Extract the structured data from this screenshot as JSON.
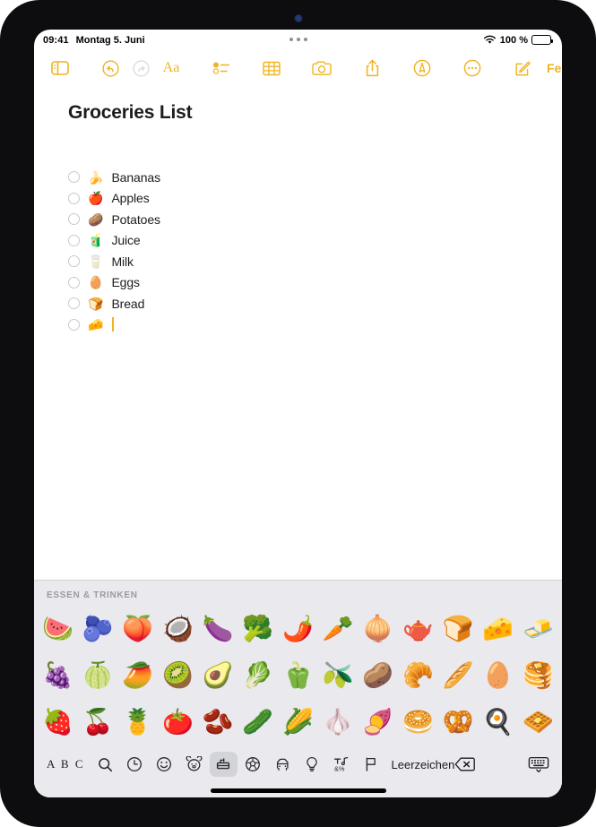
{
  "status_bar": {
    "time": "09:41",
    "date": "Montag 5. Juni",
    "wifi_icon": "wifi-icon",
    "battery_percent": "100 %",
    "battery_level": 100,
    "multitasking_icon": "multitasking-dots-icon"
  },
  "toolbar": {
    "sidebar_label": "sidebar-toggle",
    "undo_label": "undo",
    "redo_label": "redo",
    "format_label": "Aa",
    "checklist_label": "checklist",
    "table_label": "table",
    "camera_label": "camera",
    "share_label": "share",
    "markup_label": "markup",
    "more_label": "more",
    "compose_label": "compose",
    "done_label": "Fertig",
    "accent_color": "#EFB324",
    "disabled_color": "#DCDCDC"
  },
  "note": {
    "title": "Groceries List",
    "checklist": [
      {
        "checked": false,
        "emoji": "🍌",
        "text": "Bananas"
      },
      {
        "checked": false,
        "emoji": "🍎",
        "text": "Apples"
      },
      {
        "checked": false,
        "emoji": "🥔",
        "text": "Potatoes"
      },
      {
        "checked": false,
        "emoji": "🧃",
        "text": "Juice"
      },
      {
        "checked": false,
        "emoji": "🥛",
        "text": "Milk"
      },
      {
        "checked": false,
        "emoji": "🥚",
        "text": "Eggs"
      },
      {
        "checked": false,
        "emoji": "🍞",
        "text": "Bread"
      },
      {
        "checked": false,
        "emoji": "🧀",
        "text": "",
        "has_caret": true
      }
    ]
  },
  "keyboard": {
    "section_title": "ESSEN & TRINKEN",
    "emoji_rows": [
      [
        "🍉",
        "🫐",
        "🍑",
        "🥥",
        "🍆",
        "🥦",
        "🌶️",
        "🥕",
        "🧅",
        "🫖",
        "🍞",
        "🧀",
        "🧈"
      ],
      [
        "🍇",
        "🍈",
        "🥭",
        "🥝",
        "🥑",
        "🥬",
        "🫑",
        "🫒",
        "🥔",
        "🥐",
        "🥖",
        "🥚",
        "🥞"
      ],
      [
        "🍓",
        "🍒",
        "🍍",
        "🍅",
        "🫘",
        "🥒",
        "🌽",
        "🧄",
        "🍠",
        "🥯",
        "🥨",
        "🍳",
        "🧇"
      ]
    ],
    "bottom_bar": {
      "abc_label": "A B C",
      "search_label": "search",
      "recents_label": "recents",
      "smileys_label": "smileys-and-people",
      "animals_label": "animals-and-nature",
      "food_label": "food-and-drink",
      "activities_label": "activities",
      "travel_label": "travel-and-places",
      "objects_label": "objects",
      "symbols_label": "symbols",
      "flags_label": "flags",
      "space_label": "Leerzeichen",
      "delete_label": "delete",
      "hide_keyboard_label": "hide-keyboard",
      "selected_category": "food-and-drink",
      "selected_background": "#D3D3DA"
    }
  }
}
